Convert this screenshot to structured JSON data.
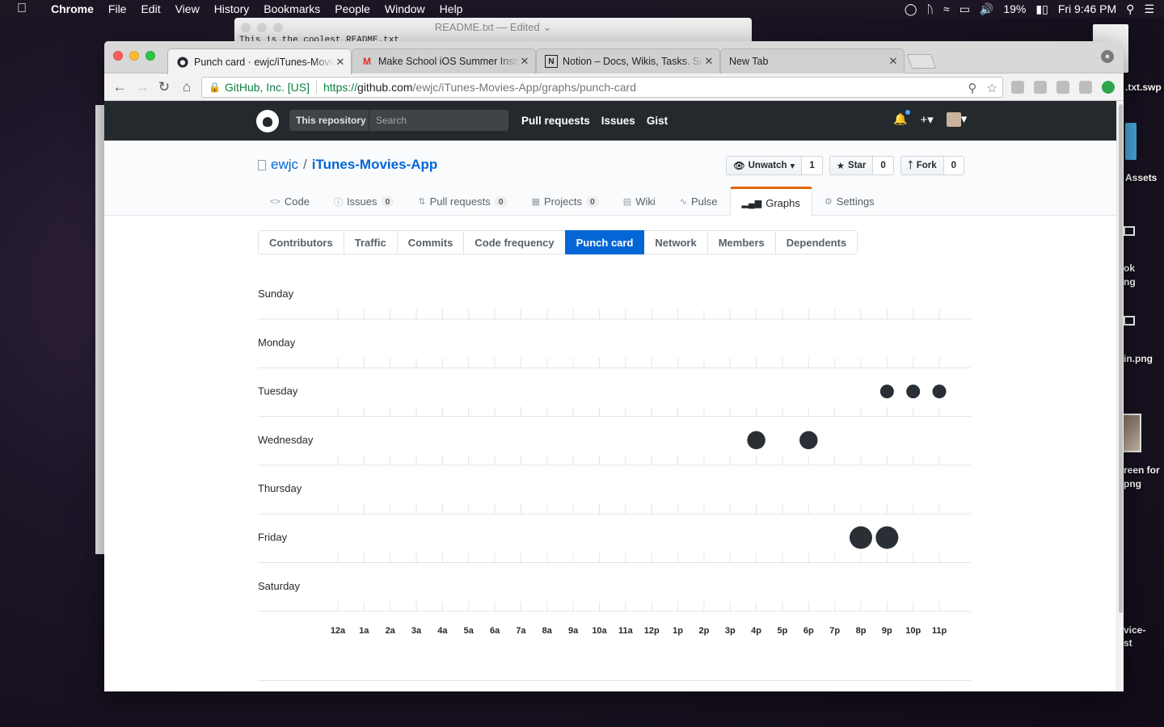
{
  "menubar": {
    "app": "Chrome",
    "items": [
      "File",
      "Edit",
      "View",
      "History",
      "Bookmarks",
      "People",
      "Window",
      "Help"
    ],
    "battery": "19%",
    "clock": "Fri 9:46 PM"
  },
  "bg_editor": {
    "title": "README.txt — Edited ⌄",
    "content": "This is the coolest README.txt"
  },
  "desktop": {
    "labels": [
      ".txt.swp",
      "Assets",
      "ok",
      "ng",
      "in.png",
      "reen for",
      "png",
      "vice-",
      "st"
    ]
  },
  "browser": {
    "tabs": [
      {
        "title": "Punch card · ewjc/iTunes-Movies-App",
        "favicon": "github-icon",
        "active": true
      },
      {
        "title": "Make School iOS Summer Instructors",
        "favicon": "gmail-icon",
        "active": false
      },
      {
        "title": "Notion – Docs, Wikis, Tasks. Simple.",
        "favicon": "notion-icon",
        "active": false
      },
      {
        "title": "New Tab",
        "favicon": "",
        "active": false
      }
    ],
    "omnibox": {
      "ev_name": "GitHub, Inc. [US]",
      "scheme": "https://",
      "host": "github.com",
      "path": "/ewjc/iTunes-Movies-App/graphs/punch-card"
    }
  },
  "github": {
    "header": {
      "scope": "This repository",
      "search_placeholder": "Search",
      "nav": [
        "Pull requests",
        "Issues",
        "Gist"
      ]
    },
    "repo": {
      "owner": "ewjc",
      "separator": "/",
      "name": "iTunes-Movies-App"
    },
    "actions": [
      {
        "label": "Unwatch",
        "count": "1",
        "icon": "eye-icon"
      },
      {
        "label": "Star",
        "count": "0",
        "icon": "star-icon"
      },
      {
        "label": "Fork",
        "count": "0",
        "icon": "fork-icon"
      }
    ],
    "reponav": [
      {
        "label": "Code",
        "count": "",
        "selected": false
      },
      {
        "label": "Issues",
        "count": "0",
        "selected": false
      },
      {
        "label": "Pull requests",
        "count": "0",
        "selected": false
      },
      {
        "label": "Projects",
        "count": "0",
        "selected": false
      },
      {
        "label": "Wiki",
        "count": "",
        "selected": false
      },
      {
        "label": "Pulse",
        "count": "",
        "selected": false
      },
      {
        "label": "Graphs",
        "count": "",
        "selected": true
      },
      {
        "label": "Settings",
        "count": "",
        "selected": false
      }
    ],
    "subnav": [
      "Contributors",
      "Traffic",
      "Commits",
      "Code frequency",
      "Punch card",
      "Network",
      "Members",
      "Dependents"
    ],
    "subnav_selected": "Punch card"
  },
  "chart_data": {
    "type": "scatter",
    "days": [
      "Sunday",
      "Monday",
      "Tuesday",
      "Wednesday",
      "Thursday",
      "Friday",
      "Saturday"
    ],
    "hours": [
      "12a",
      "1a",
      "2a",
      "3a",
      "4a",
      "5a",
      "6a",
      "7a",
      "8a",
      "9a",
      "10a",
      "11a",
      "12p",
      "1p",
      "2p",
      "3p",
      "4p",
      "5p",
      "6p",
      "7p",
      "8p",
      "9p",
      "10p",
      "11p"
    ],
    "points": [
      {
        "day": "Tuesday",
        "hour": "9p",
        "commits": 1
      },
      {
        "day": "Tuesday",
        "hour": "10p",
        "commits": 1
      },
      {
        "day": "Tuesday",
        "hour": "11p",
        "commits": 1
      },
      {
        "day": "Wednesday",
        "hour": "4p",
        "commits": 2
      },
      {
        "day": "Wednesday",
        "hour": "6p",
        "commits": 2
      },
      {
        "day": "Friday",
        "hour": "8p",
        "commits": 3
      },
      {
        "day": "Friday",
        "hour": "9p",
        "commits": 3
      }
    ],
    "dot_color": "#2a2f36"
  }
}
